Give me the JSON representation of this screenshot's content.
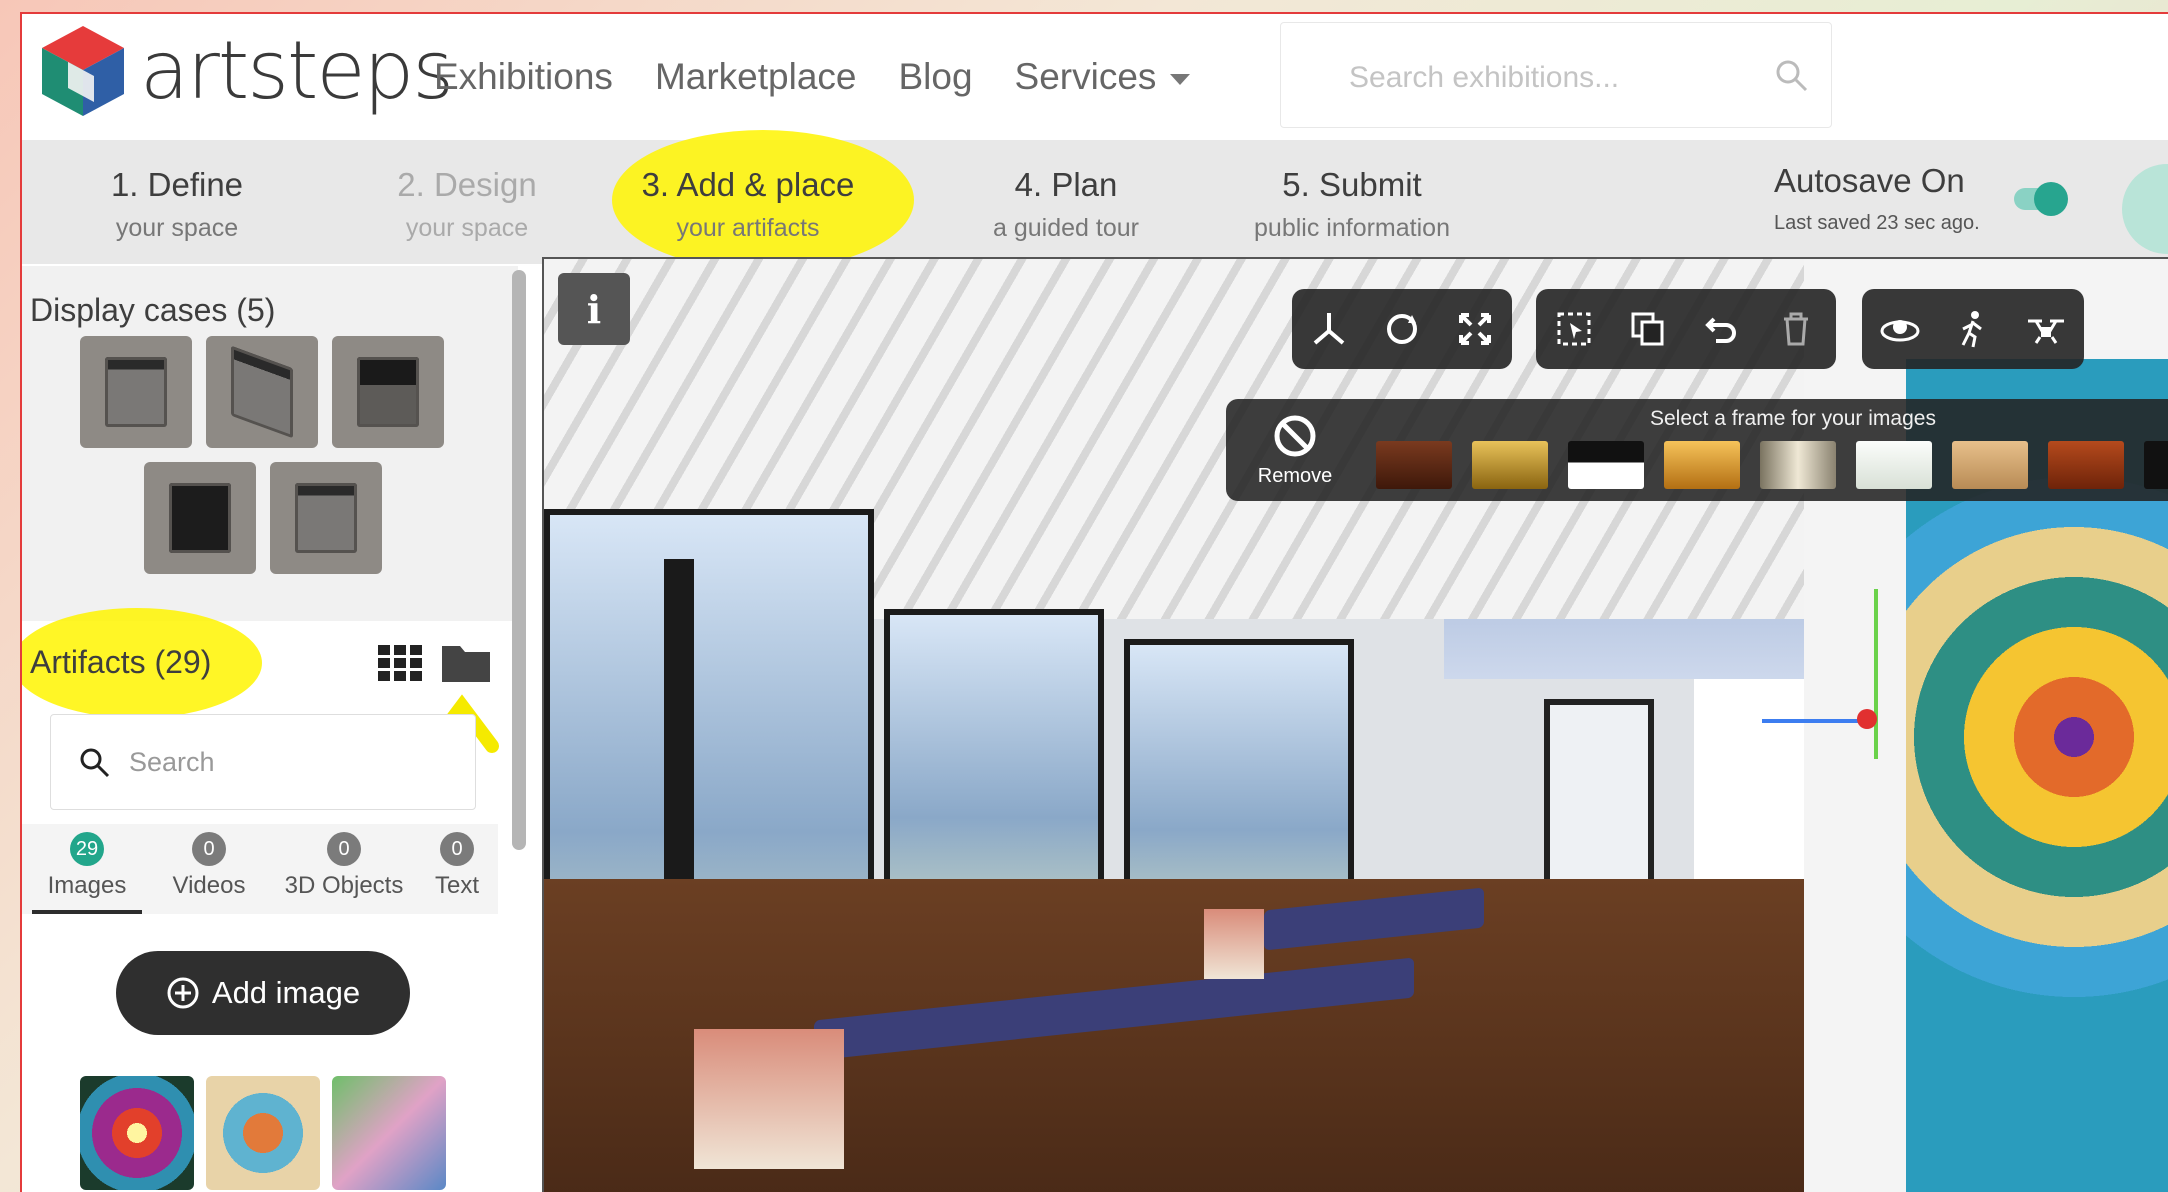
{
  "brand": {
    "name": "artsteps"
  },
  "nav": {
    "links": [
      "Exhibitions",
      "Marketplace",
      "Blog",
      "Services"
    ],
    "search_placeholder": "Search exhibitions..."
  },
  "steps": [
    {
      "title": "1. Define",
      "subtitle": "your space"
    },
    {
      "title": "2. Design",
      "subtitle": "your space"
    },
    {
      "title": "3. Add & place",
      "subtitle": "your artifacts"
    },
    {
      "title": "4. Plan",
      "subtitle": "a guided tour"
    },
    {
      "title": "5. Submit",
      "subtitle": "public information"
    }
  ],
  "autosave": {
    "title": "Autosave On",
    "last_saved": "Last saved 23 sec ago."
  },
  "sidebar": {
    "display_cases_title": "Display cases (5)",
    "artifacts_title": "Artifacts (29)",
    "search_placeholder": "Search",
    "tabs": [
      {
        "label": "Images",
        "count": "29"
      },
      {
        "label": "Videos",
        "count": "0"
      },
      {
        "label": "3D Objects",
        "count": "0"
      },
      {
        "label": "Text",
        "count": "0"
      }
    ],
    "add_button": "Add image"
  },
  "viewport": {
    "info_label": "i",
    "frame_bar_title": "Select a frame for your images",
    "remove_label": "Remove",
    "frame_swatches": [
      "#5a2b18",
      "#c6951f",
      "#111111",
      "#d8962a",
      "#bfb9a8",
      "#f3f6f2",
      "#d5ad78",
      "#8b3516"
    ]
  },
  "colors": {
    "accent": "#27a58f",
    "highlight": "#fff400",
    "border": "#e43b3b"
  }
}
